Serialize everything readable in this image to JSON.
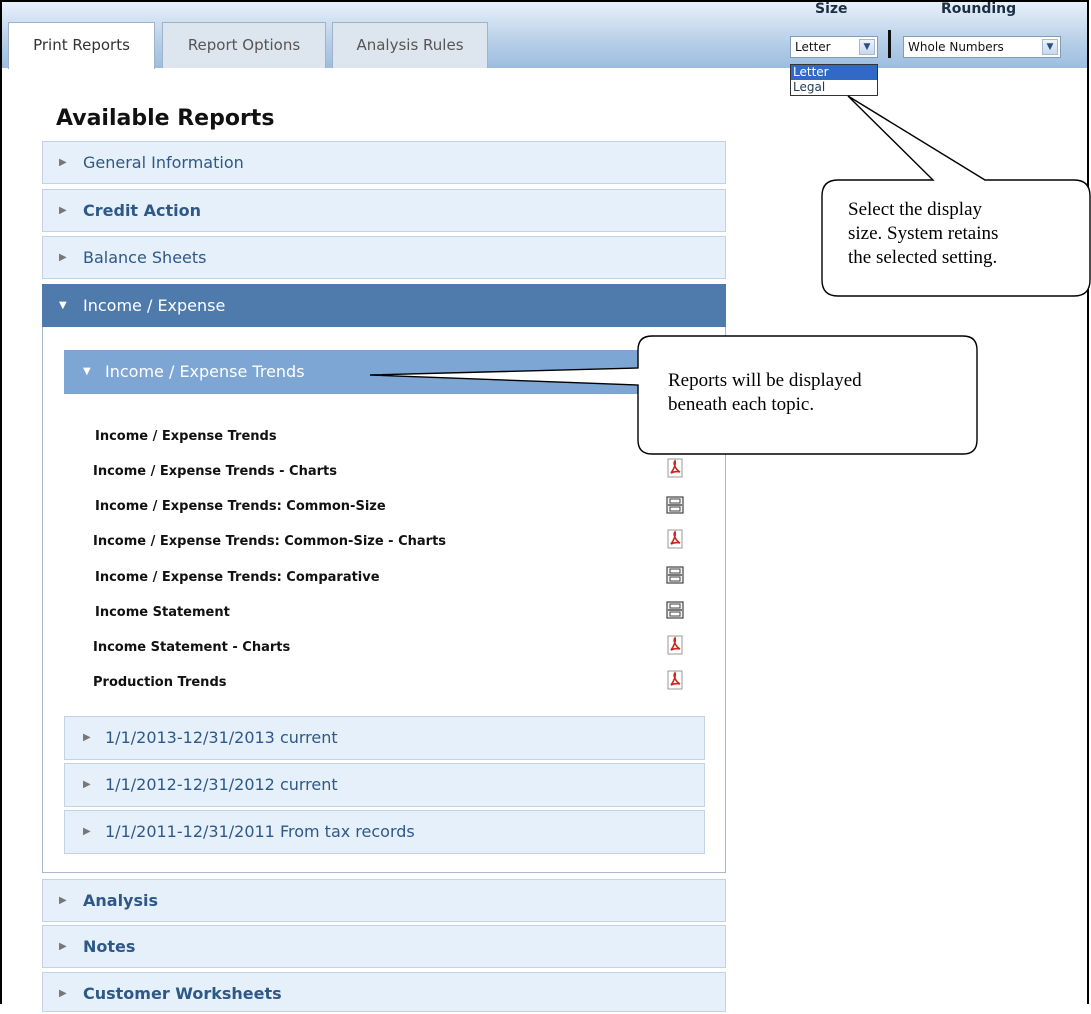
{
  "tabs": [
    "Print Reports",
    "Report Options",
    "Analysis Rules"
  ],
  "controls": {
    "size_label": "Size",
    "size_value": "Letter",
    "size_options": [
      "Letter",
      "Legal"
    ],
    "rounding_label": "Rounding",
    "rounding_value": "Whole Numbers"
  },
  "title": "Available Reports",
  "sections": {
    "general": "General Information",
    "credit": "Credit Action",
    "balance": "Balance Sheets",
    "income": "Income / Expense",
    "analysis": "Analysis",
    "notes": "Notes",
    "worksheets": "Customer Worksheets"
  },
  "subsections": {
    "trends": "Income / Expense Trends",
    "y2013": "1/1/2013-12/31/2013 current",
    "y2012": "1/1/2012-12/31/2012 current",
    "y2011": "1/1/2011-12/31/2011 From tax records"
  },
  "reports": [
    {
      "name": "Income / Expense Trends",
      "icon": "none"
    },
    {
      "name": "Income / Expense Trends - Charts",
      "icon": "pdf-icon"
    },
    {
      "name": "Income / Expense Trends: Common-Size",
      "icon": "printer-icon"
    },
    {
      "name": "Income / Expense Trends: Common-Size - Charts",
      "icon": "pdf-icon"
    },
    {
      "name": "Income / Expense Trends: Comparative",
      "icon": "printer-icon"
    },
    {
      "name": "Income Statement",
      "icon": "printer-icon"
    },
    {
      "name": "Income Statement - Charts",
      "icon": "pdf-icon"
    },
    {
      "name": "Production Trends",
      "icon": "pdf-icon"
    }
  ],
  "callouts": {
    "size_note": [
      "Select the display",
      "size.  System retains",
      "the selected setting."
    ],
    "reports_note": [
      "Reports will be displayed",
      "beneath each topic."
    ]
  }
}
